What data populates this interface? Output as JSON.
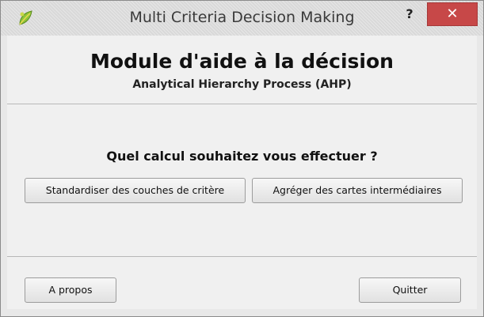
{
  "window": {
    "title": "Multi Criteria Decision Making",
    "help_label": "?",
    "close_label": "✕"
  },
  "icons": {
    "app": "qgis-leaf-icon"
  },
  "colors": {
    "close_button": "#c74848",
    "panel_background": "#f0f0f0",
    "titlebar_background": "#d9d9d9"
  },
  "header": {
    "title": "Module d'aide à la décision",
    "subtitle": "Analytical Hierarchy Process (AHP)"
  },
  "main": {
    "question": "Quel calcul souhaitez vous effectuer ?",
    "standardize_label": "Standardiser des couches de critère",
    "aggregate_label": "Agréger des cartes intermédiaires"
  },
  "footer": {
    "about_label": "A propos",
    "quit_label": "Quitter"
  }
}
